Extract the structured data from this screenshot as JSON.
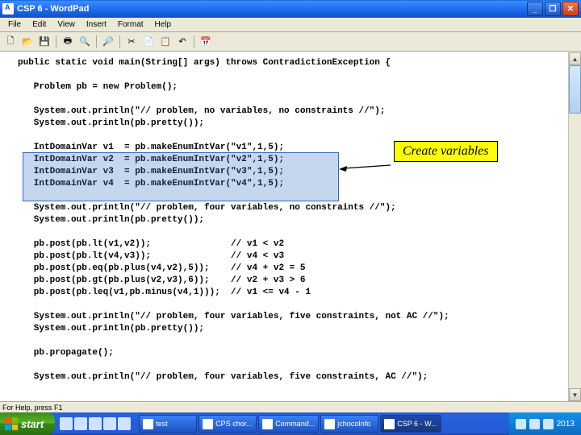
{
  "window": {
    "title": "CSP 6 - WordPad",
    "min": "_",
    "max": "❐",
    "close": "✕"
  },
  "menu": {
    "file": "File",
    "edit": "Edit",
    "view": "View",
    "insert": "Insert",
    "format": "Format",
    "help": "Help"
  },
  "toolbar": {
    "new": "🗋",
    "open": "📂",
    "save": "💾",
    "print": "🖶",
    "preview": "🔍",
    "find": "🔎",
    "cut": "✂",
    "copy": "📄",
    "paste": "📋",
    "undo": "↶",
    "date": "📅"
  },
  "callout": {
    "text": "Create variables"
  },
  "code": {
    "text": "public static void main(String[] args) throws ContradictionException {\n\n   Problem pb = new Problem();\n\n   System.out.println(\"// problem, no variables, no constraints //\");\n   System.out.println(pb.pretty());\n\n   IntDomainVar v1  = pb.makeEnumIntVar(\"v1\",1,5);\n   IntDomainVar v2  = pb.makeEnumIntVar(\"v2\",1,5);\n   IntDomainVar v3  = pb.makeEnumIntVar(\"v3\",1,5);\n   IntDomainVar v4  = pb.makeEnumIntVar(\"v4\",1,5);\n\n   System.out.println(\"// problem, four variables, no constraints //\");\n   System.out.println(pb.pretty());\n\n   pb.post(pb.lt(v1,v2));               // v1 < v2\n   pb.post(pb.lt(v4,v3));               // v4 < v3\n   pb.post(pb.eq(pb.plus(v4,v2),5));    // v4 + v2 = 5\n   pb.post(pb.gt(pb.plus(v2,v3),6));    // v2 + v3 > 6\n   pb.post(pb.leq(v1,pb.minus(v4,1)));  // v1 <= v4 - 1\n\n   System.out.println(\"// problem, four variables, five constraints, not AC //\");\n   System.out.println(pb.pretty());\n\n   pb.propagate();\n\n   System.out.println(\"// problem, four variables, five constraints, AC //\");"
  },
  "status": {
    "text": "For Help, press F1"
  },
  "taskbar": {
    "start": "start",
    "tasks": [
      {
        "label": "test"
      },
      {
        "label": "CPS chor..."
      },
      {
        "label": "Command..."
      },
      {
        "label": "jchocoInfo"
      },
      {
        "label": "CSP 6 - W..."
      }
    ],
    "clock": "2013"
  }
}
